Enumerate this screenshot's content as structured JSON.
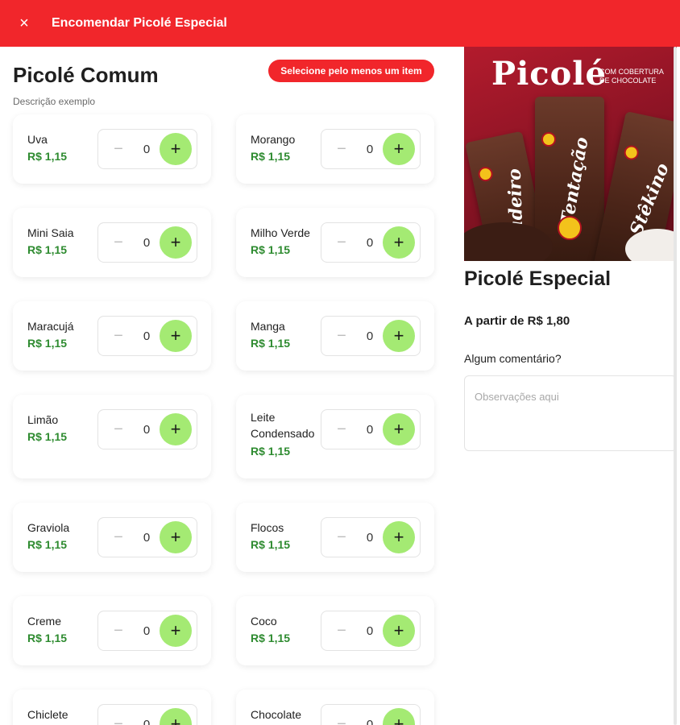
{
  "header": {
    "title": "Encomendar Picolé Especial",
    "close_icon": "×"
  },
  "section": {
    "title": "Picolé Comum",
    "description": "Descrição exemplo",
    "required_badge": "Selecione pelo menos um item"
  },
  "items": [
    {
      "name": "Uva",
      "price": "R$ 1,15",
      "qty": "0"
    },
    {
      "name": "Morango",
      "price": "R$ 1,15",
      "qty": "0"
    },
    {
      "name": "Mini Saia",
      "price": "R$ 1,15",
      "qty": "0"
    },
    {
      "name": "Milho Verde",
      "price": "R$ 1,15",
      "qty": "0"
    },
    {
      "name": "Maracujá",
      "price": "R$ 1,15",
      "qty": "0"
    },
    {
      "name": "Manga",
      "price": "R$ 1,15",
      "qty": "0"
    },
    {
      "name": "Limão",
      "price": "R$ 1,15",
      "qty": "0"
    },
    {
      "name": "Leite Condensado",
      "price": "R$ 1,15",
      "qty": "0"
    },
    {
      "name": "Graviola",
      "price": "R$ 1,15",
      "qty": "0"
    },
    {
      "name": "Flocos",
      "price": "R$ 1,15",
      "qty": "0"
    },
    {
      "name": "Creme",
      "price": "R$ 1,15",
      "qty": "0"
    },
    {
      "name": "Coco",
      "price": "R$ 1,15",
      "qty": "0"
    },
    {
      "name": "Chiclete",
      "price": "",
      "qty": "0"
    },
    {
      "name": "Chocolate",
      "price": "",
      "qty": "0"
    }
  ],
  "stepper": {
    "minus_icon": "−",
    "plus_icon": "+"
  },
  "product": {
    "name": "Picolé Especial",
    "price_from": "A partir de R$ 1,80",
    "comment_label": "Algum comentário?",
    "comment_placeholder": "Observações aqui",
    "hero": {
      "logo_text": "Picolé",
      "sub_text_line1": "com cobertura",
      "sub_text_line2": "de chocolate",
      "bar_labels": [
        "Brigadeiro",
        "Tentação",
        "Stêkino"
      ]
    }
  },
  "colors": {
    "brand_red": "#f1262b",
    "price_green": "#2e8b30",
    "plus_green": "#a4ea73"
  }
}
